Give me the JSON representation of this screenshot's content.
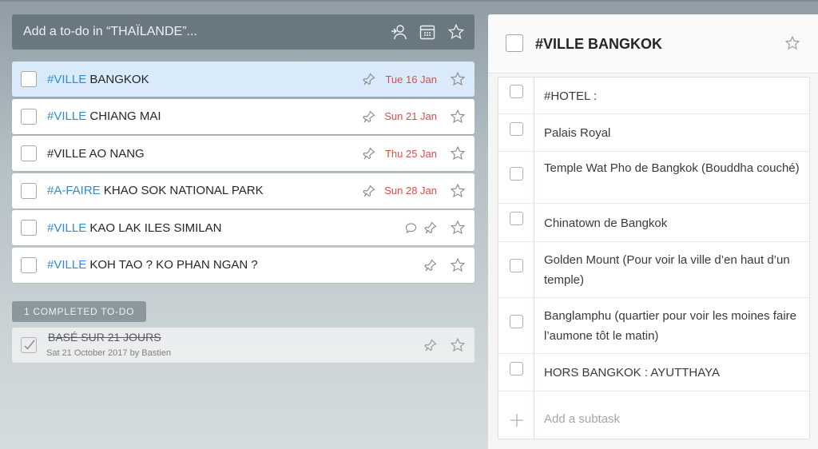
{
  "add_bar": {
    "placeholder": "Add a to-do in “THAÏLANDE”..."
  },
  "tasks": [
    {
      "tag": "#VILLE",
      "title": " BANGKOK",
      "date": "Tue 16 Jan",
      "selected": true
    },
    {
      "tag": "#VILLE",
      "title": " CHIANG MAI",
      "date": "Sun 21 Jan"
    },
    {
      "tag": "",
      "title": "#VILLE AO NANG",
      "date": "Thu 25 Jan"
    },
    {
      "tag": "#A-FAIRE",
      "title": " KHAO SOK NATIONAL PARK",
      "date": "Sun 28 Jan"
    },
    {
      "tag": "#VILLE",
      "title": " KAO LAK ILES SIMILAN",
      "date": "",
      "has_note": true
    },
    {
      "tag": "#VILLE",
      "title": " KOH TAO ? KO PHAN NGAN ?",
      "date": ""
    }
  ],
  "completed": {
    "label": "1 COMPLETED TO-DO",
    "item_title": "BASÉ SUR 21 JOURS",
    "item_meta": "Sat 21 October 2017 by Bastien"
  },
  "detail": {
    "title": "#VILLE BANGKOK",
    "subtasks": [
      "#HOTEL :",
      "Palais Royal",
      "Temple Wat Pho de Bangkok (Bouddha couché)",
      "Chinatown de Bangkok",
      "Golden Mount (Pour voir la ville d’en haut d’un temple)",
      "Banglamphu (quartier pour voir les moines faire l’aumone tôt le matin)",
      "HORS BANGKOK : AYUTTHAYA"
    ],
    "add_subtask_placeholder": "Add a subtask"
  },
  "colors": {
    "accent_tag": "#328ad6",
    "due_date": "#d74e48",
    "selected_bg": "#d9ebfb"
  },
  "icons": [
    "assign-user-icon",
    "calendar-icon",
    "star-icon",
    "pin-icon",
    "note-icon",
    "checkbox-icon",
    "plus-icon"
  ]
}
